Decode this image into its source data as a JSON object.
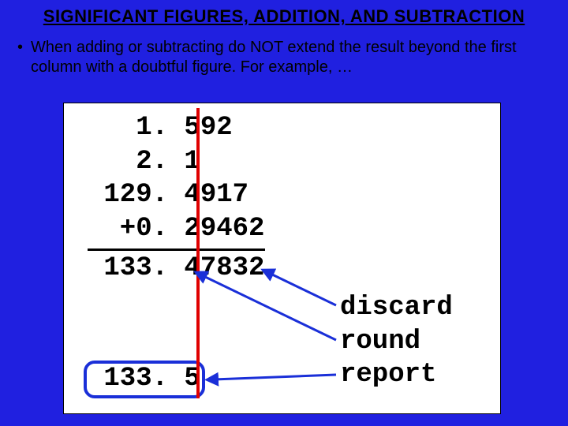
{
  "title": "SIGNIFICANT FIGURES, ADDITION, AND SUBTRACTION",
  "bullet": "When adding or subtracting do NOT extend the result beyond the first column with a doubtful figure.  For example, …",
  "numbers": {
    "n1": "   1. 592",
    "n2": "   2. 1",
    "n3": " 129. 4917",
    "n4": "  +0. 29462"
  },
  "sum": " 133. 47832",
  "final": " 133. 5",
  "labels": {
    "l1": "discard",
    "l2": "round",
    "l3": "report"
  }
}
